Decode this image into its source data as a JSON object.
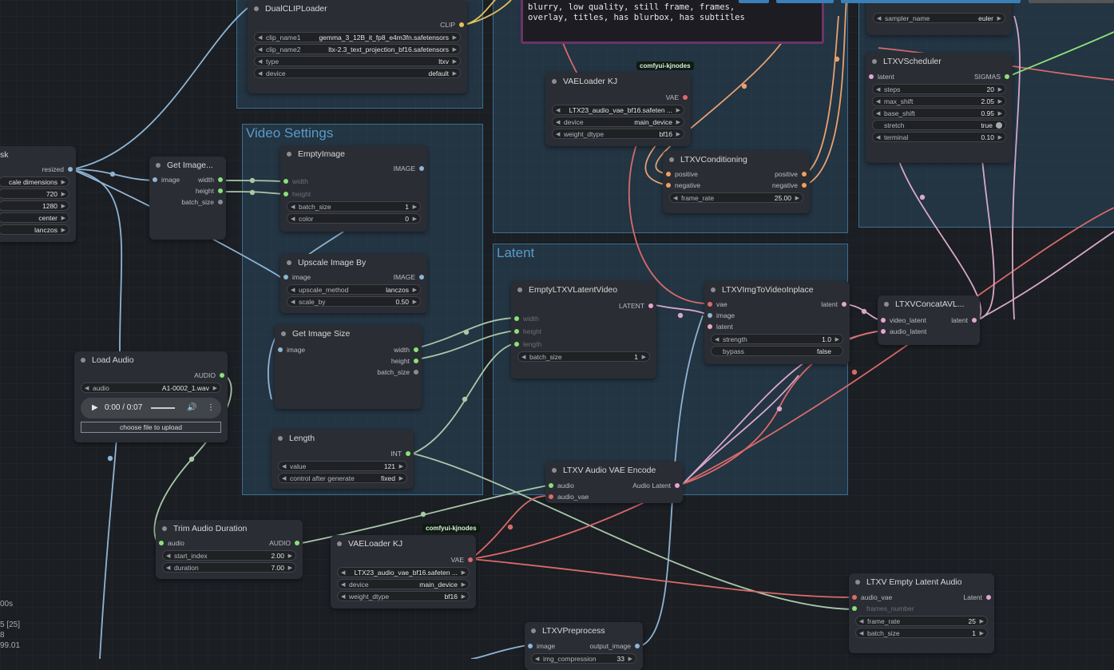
{
  "colors": {
    "clip": "#e8c45a",
    "vae": "#e06a6a",
    "int": "#8ae27a",
    "image": "#80b4e0",
    "audio": "#8ae27a",
    "latent": "#e4a4d4",
    "sigmas": "#8ae27a",
    "conditioning": "#f0a060",
    "model": "#b4b4f0"
  },
  "groups": {
    "video_settings": "Video Settings",
    "latent": "Latent"
  },
  "prompt_text": "blurry, low quality, still frame, frames,\noverlay, titles, has blurbox, has subtitles",
  "badges": [
    "comfyui-kjnodes",
    "comfyui-kjnodes"
  ],
  "stats": [
    "00s",
    "5 [25]",
    "8",
    "99.01"
  ],
  "nodes": {
    "resize": {
      "title": "sk",
      "out": "resized",
      "widgets": [
        {
          "val": "cale dimensions"
        },
        {
          "val": "720"
        },
        {
          "val": "1280"
        },
        {
          "val": "center"
        },
        {
          "val": "lanczos"
        }
      ]
    },
    "dualclip": {
      "title": "DualCLIPLoader",
      "out": "CLIP",
      "widgets": [
        {
          "label": "clip_name1",
          "val": "gemma_3_12B_it_fp8_e4m3fn.safetensors"
        },
        {
          "label": "clip_name2",
          "val": "ltx-2.3_text_projection_bf16.safetensors"
        },
        {
          "label": "type",
          "val": "ltxv"
        },
        {
          "label": "device",
          "val": "default"
        }
      ]
    },
    "getimage1": {
      "title": "Get Image...",
      "in": "image",
      "outs": [
        "width",
        "height",
        "batch_size"
      ]
    },
    "emptyimage": {
      "title": "EmptyImage",
      "out": "IMAGE",
      "ins": [
        "width",
        "height"
      ],
      "widgets": [
        {
          "label": "batch_size",
          "val": "1"
        },
        {
          "label": "color",
          "val": "0"
        }
      ]
    },
    "upscale": {
      "title": "Upscale Image By",
      "in": "image",
      "out": "IMAGE",
      "widgets": [
        {
          "label": "upscale_method",
          "val": "lanczos"
        },
        {
          "label": "scale_by",
          "val": "0.50"
        }
      ]
    },
    "getimagesize": {
      "title": "Get Image Size",
      "in": "image",
      "outs": [
        "width",
        "height",
        "batch_size"
      ]
    },
    "length": {
      "title": "Length",
      "out": "INT",
      "widgets": [
        {
          "label": "value",
          "val": "121"
        },
        {
          "label": "control after generate",
          "val": "fixed"
        }
      ]
    },
    "loadaudio": {
      "title": "Load Audio",
      "out": "AUDIO",
      "widgets": [
        {
          "label": "audio",
          "val": "A1-0002_1.wav"
        }
      ],
      "player_time": "0:00 / 0:07",
      "upload": "choose file to upload"
    },
    "trimaudio": {
      "title": "Trim Audio Duration",
      "in": "audio",
      "out": "AUDIO",
      "widgets": [
        {
          "label": "start_index",
          "val": "2.00"
        },
        {
          "label": "duration",
          "val": "7.00"
        }
      ]
    },
    "vaeloader_top": {
      "title": "VAELoader KJ",
      "out": "VAE",
      "widgets": [
        {
          "val": "LTX23_audio_vae_bf16.safeten ..."
        },
        {
          "label": "device",
          "val": "main_device"
        },
        {
          "label": "weight_dtype",
          "val": "bf16"
        }
      ]
    },
    "vaeloader_bottom": {
      "title": "VAELoader KJ",
      "out": "VAE",
      "widgets": [
        {
          "val": "LTX23_audio_vae_bf16.safeten ..."
        },
        {
          "label": "device",
          "val": "main_device"
        },
        {
          "label": "weight_dtype",
          "val": "bf16"
        }
      ]
    },
    "conditioning": {
      "title": "LTXVConditioning",
      "ins": [
        "positive",
        "negative"
      ],
      "outs": [
        "positive",
        "negative"
      ],
      "widgets": [
        {
          "label": "frame_rate",
          "val": "25.00"
        }
      ]
    },
    "sampler": {
      "widgets": [
        {
          "label": "sampler_name",
          "val": "euler"
        }
      ]
    },
    "scheduler": {
      "title": "LTXVScheduler",
      "in": "latent",
      "out": "SIGMAS",
      "widgets": [
        {
          "label": "steps",
          "val": "20"
        },
        {
          "label": "max_shift",
          "val": "2.05"
        },
        {
          "label": "base_shift",
          "val": "0.95"
        },
        {
          "label": "stretch",
          "val": "true"
        },
        {
          "label": "terminal",
          "val": "0.10"
        }
      ]
    },
    "emptylatent": {
      "title": "EmptyLTXVLatentVideo",
      "out": "LATENT",
      "ins": [
        "width",
        "height",
        "length"
      ],
      "widgets": [
        {
          "label": "batch_size",
          "val": "1"
        }
      ]
    },
    "img2vid": {
      "title": "LTXVImgToVideoInplace",
      "ins": [
        "vae",
        "image",
        "latent"
      ],
      "out": "latent",
      "widgets": [
        {
          "label": "strength",
          "val": "1.0"
        },
        {
          "label": "bypass",
          "val": "false"
        }
      ]
    },
    "concat": {
      "title": "LTXVConcatAVL...",
      "ins": [
        "video_latent",
        "audio_latent"
      ],
      "out": "latent"
    },
    "audioencode": {
      "title": "LTXV Audio VAE Encode",
      "ins": [
        "audio",
        "audio_vae"
      ],
      "out": "Audio Latent"
    },
    "emptyaudio": {
      "title": "LTXV Empty Latent Audio",
      "ins": [
        "audio_vae",
        "frames_number"
      ],
      "out": "Latent",
      "widgets": [
        {
          "label": "frame_rate",
          "val": "25"
        },
        {
          "label": "batch_size",
          "val": "1"
        }
      ]
    },
    "preprocess": {
      "title": "LTXVPreprocess",
      "in": "image",
      "out": "output_image",
      "widgets": [
        {
          "label": "img_compression",
          "val": "33"
        }
      ]
    }
  }
}
